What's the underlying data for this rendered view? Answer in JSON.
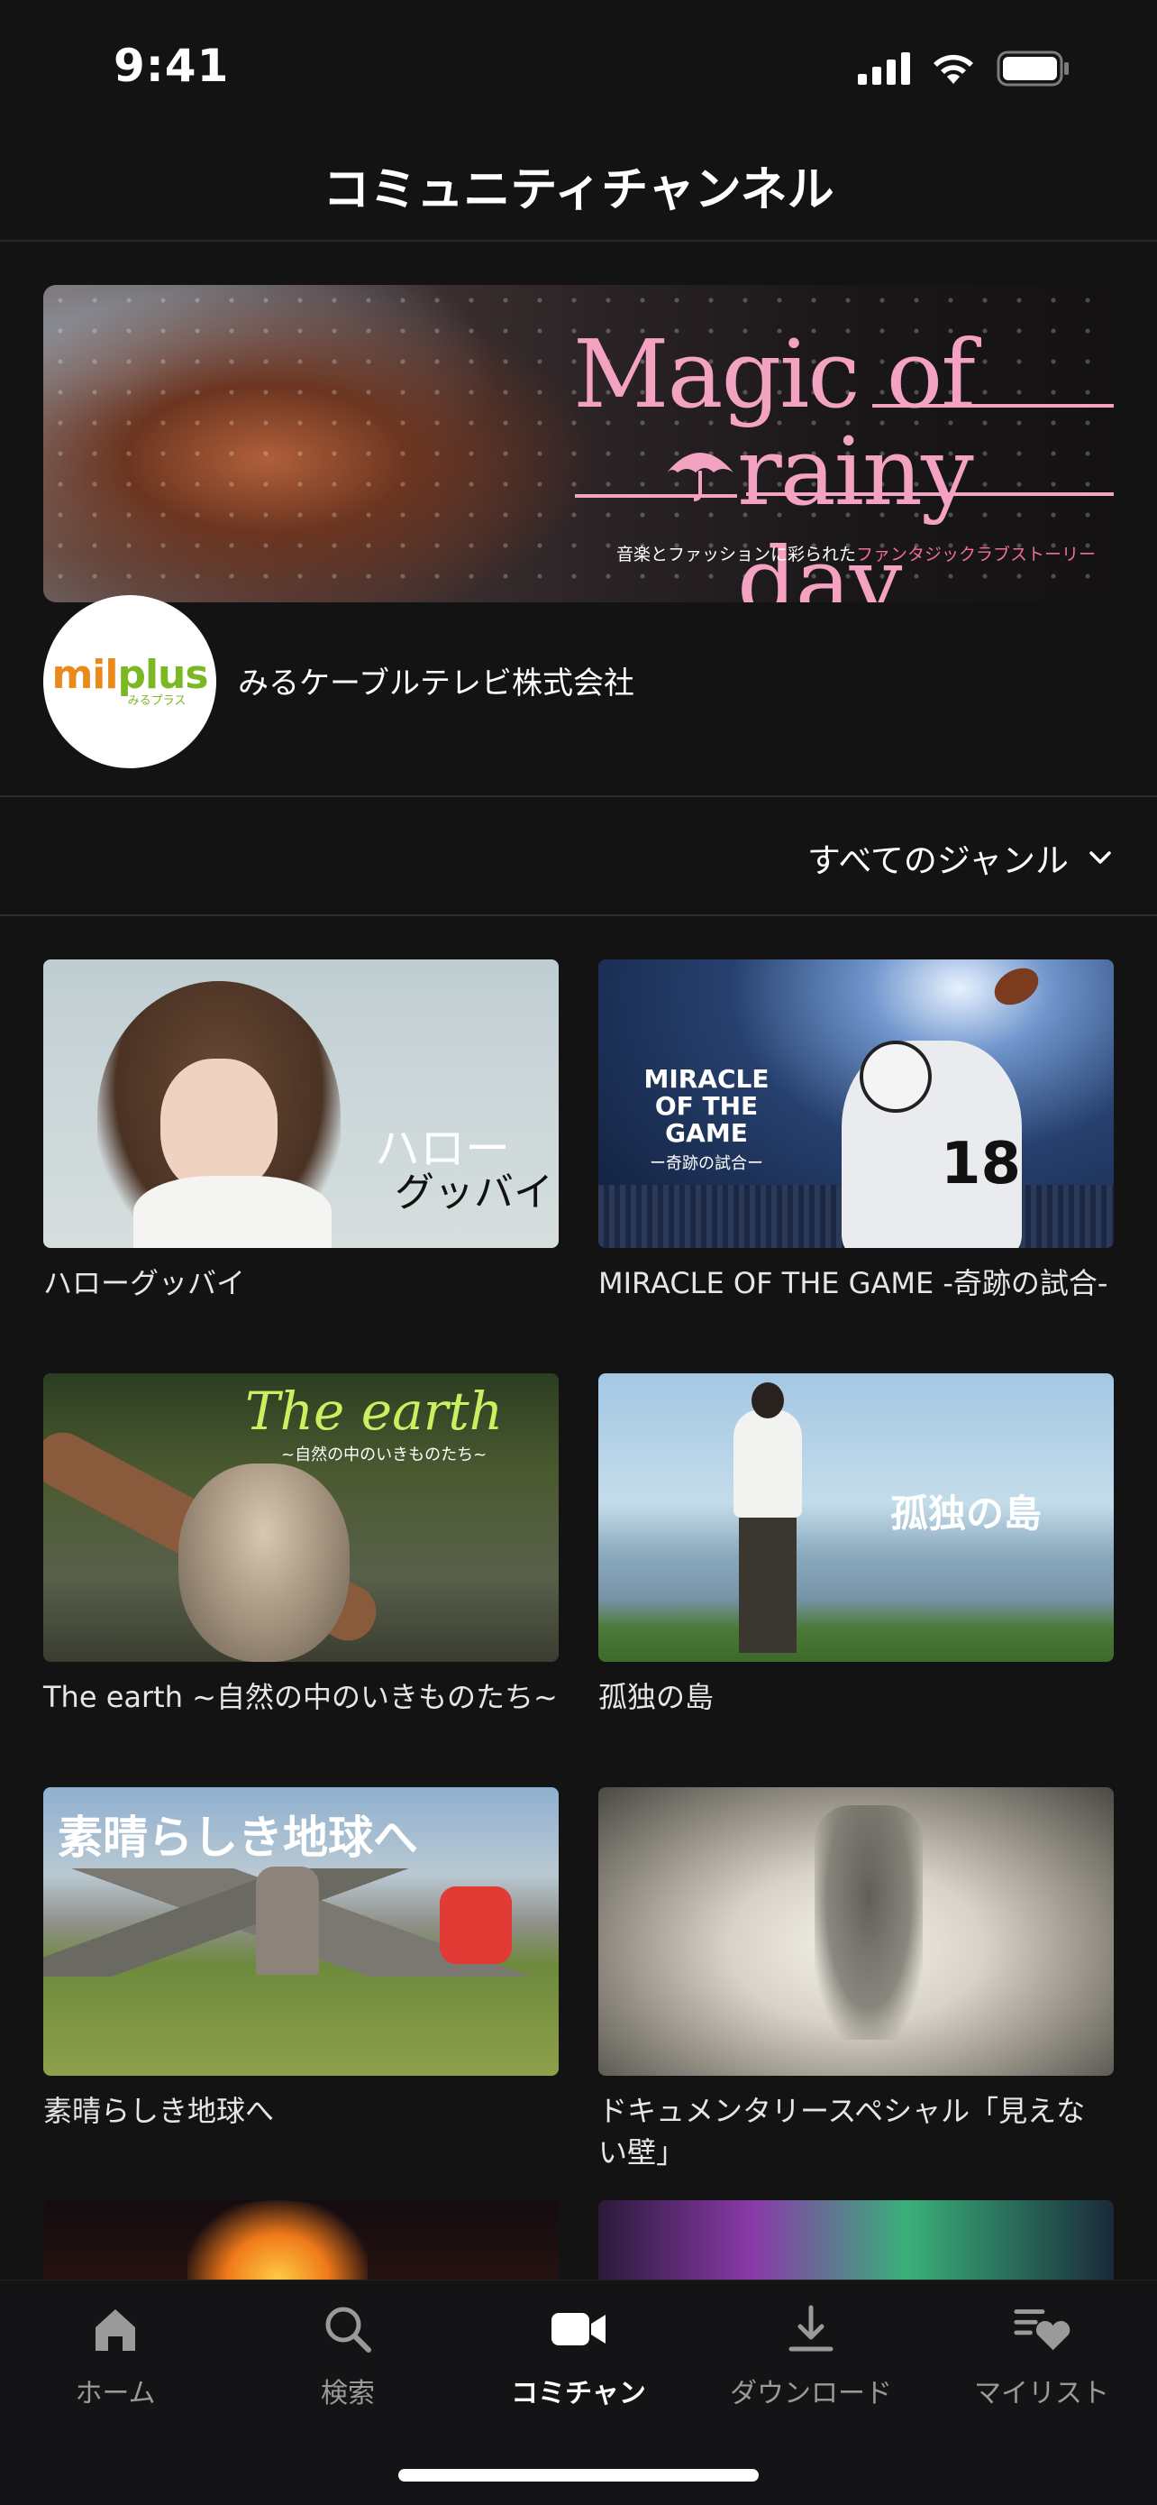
{
  "status_bar": {
    "time": "9:41"
  },
  "header": {
    "title": "コミュニティチャンネル"
  },
  "banner": {
    "title_line1": "Magic of",
    "title_line2": "rainy day",
    "subtitle_prefix": "音楽とファッションに彩られた",
    "subtitle_accent": "ファンタジックラブストーリー"
  },
  "channel": {
    "logo_mil": "mil",
    "logo_plus": "plus",
    "logo_sub": "みるプラス",
    "name": "みるケーブルテレビ株式会社"
  },
  "filter": {
    "genre_label": "すべてのジャンル"
  },
  "content": {
    "items": [
      {
        "title": "ハローグッバイ",
        "overlay_1": "ハロー",
        "overlay_2": "グッバイ"
      },
      {
        "title": "MIRACLE OF THE GAME -奇跡の試合-",
        "overlay_1": "MIRACLE OF THE GAME",
        "overlay_2": "ー奇跡の試合ー",
        "jersey_number": "18"
      },
      {
        "title": "The earth ~自然の中のいきものたち~",
        "overlay_1": "The earth",
        "overlay_2": "~自然の中のいきものたち~"
      },
      {
        "title": "孤独の島",
        "overlay_1": "孤独の島"
      },
      {
        "title": "素晴らしき地球へ",
        "overlay_1": "素晴らしき地球へ"
      },
      {
        "title": "ドキュメンタリースペシャル「見えない壁」"
      }
    ]
  },
  "tab_bar": {
    "tabs": [
      {
        "label": "ホーム",
        "icon": "home-icon"
      },
      {
        "label": "検索",
        "icon": "search-icon"
      },
      {
        "label": "コミチャン",
        "icon": "video-camera-icon",
        "active": true
      },
      {
        "label": "ダウンロード",
        "icon": "download-icon"
      },
      {
        "label": "マイリスト",
        "icon": "list-heart-icon"
      }
    ]
  },
  "colors": {
    "background": "#131314",
    "banner_pink": "#f3a2c1",
    "accent_pink": "#f06e9d",
    "logo_orange": "#e88a1c",
    "logo_green": "#7cb823"
  }
}
